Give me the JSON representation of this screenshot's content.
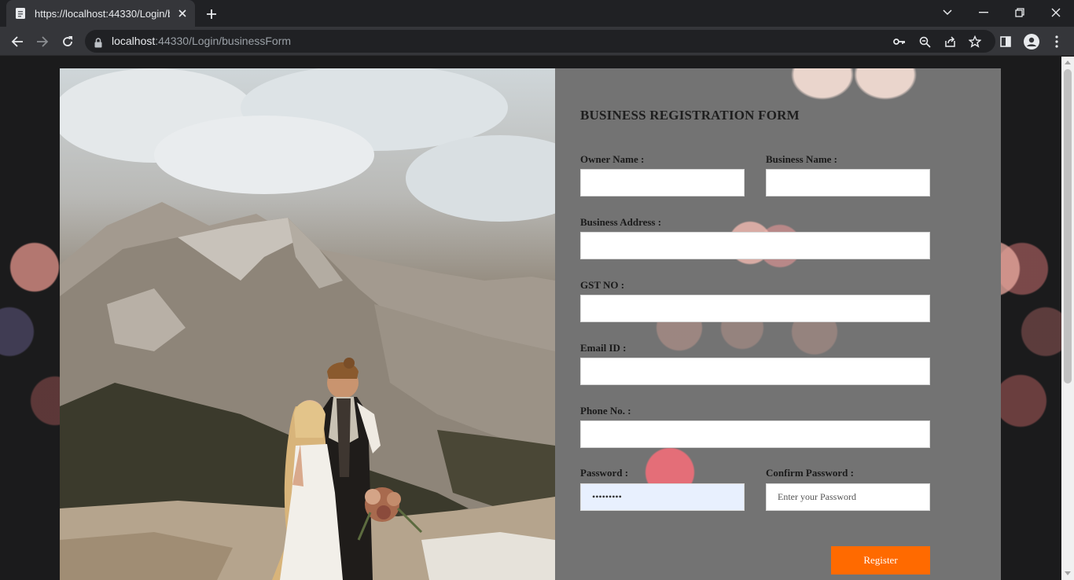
{
  "browser": {
    "tab_title": "https://localhost:44330/Login/bu",
    "url_host": "localhost",
    "url_path": ":44330/Login/businessForm",
    "icons": [
      "page-icon",
      "close-icon",
      "plus-icon",
      "chevron-down-icon",
      "minimize-icon",
      "restore-icon",
      "close-window-icon",
      "back-icon",
      "forward-icon",
      "reload-icon",
      "lock-icon",
      "key-icon",
      "zoom-icon",
      "share-icon",
      "star-icon",
      "side-panel-icon",
      "profile-icon",
      "menu-icon"
    ]
  },
  "form": {
    "title": "BUSINESS REGISTRATION FORM",
    "owner_name_label": "Owner Name :",
    "business_name_label": "Business Name :",
    "business_address_label": "Business Address :",
    "gst_label": "GST NO :",
    "email_label": "Email ID :",
    "phone_label": "Phone No. :",
    "password_label": "Password :",
    "confirm_password_label": "Confirm Password :",
    "password_value": "•••••••••",
    "confirm_password_placeholder": "Enter your Password",
    "register_label": "Register"
  },
  "colors": {
    "accent": "#ff6a00",
    "panel": "#737373",
    "autofill": "#e8f0fe"
  }
}
